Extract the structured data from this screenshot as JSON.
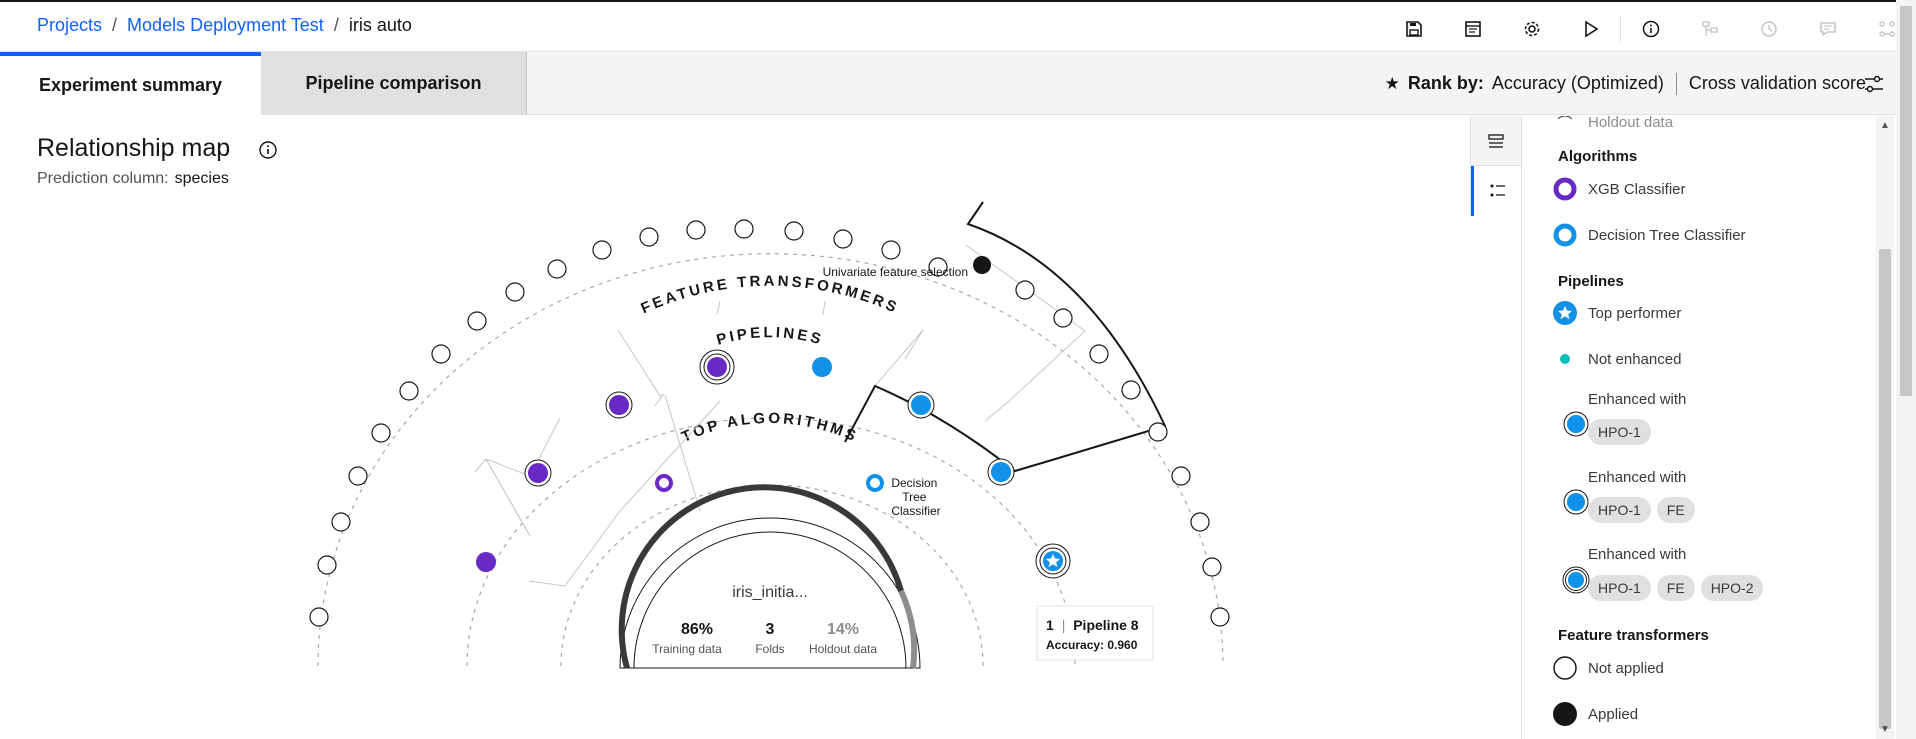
{
  "breadcrumb": {
    "projects": "Projects",
    "project": "Models Deployment Test",
    "current": "iris auto",
    "sep": "/"
  },
  "toolbar": {
    "icons": [
      "save-icon",
      "notebook-icon",
      "settings-icon",
      "run-icon",
      "info-icon",
      "pipeline-icon",
      "history-icon",
      "comment-icon",
      "compare-icon"
    ]
  },
  "tabs": {
    "summary": "Experiment summary",
    "comparison": "Pipeline comparison"
  },
  "rank_by": {
    "label": "Rank by:",
    "metric": "Accuracy (Optimized)",
    "score": "Cross validation score"
  },
  "map": {
    "title": "Relationship map",
    "prediction_label": "Prediction column:",
    "prediction_value": "species",
    "ring_feature_transformers": "FEATURE TRANSFORMERS",
    "ring_pipelines": "PIPELINES",
    "ring_top_algorithms": "TOP ALGORITHMS",
    "feature_label": "Univariate feature selection",
    "algorithm_label_1": "Decision",
    "algorithm_label_2": "Tree",
    "algorithm_label_3": "Classifier",
    "center_name": "iris_initia...",
    "stat_training_value": "86%",
    "stat_training_label": "Training data",
    "stat_folds_value": "3",
    "stat_folds_label": "Folds",
    "stat_holdout_value": "14%",
    "stat_holdout_label": "Holdout data",
    "tooltip_rank": "1",
    "tooltip_sep": "|",
    "tooltip_name": "Pipeline 8",
    "tooltip_metric": "Accuracy: 0.960"
  },
  "legend": {
    "partial_top": "Holdout data",
    "algorithms_heading": "Algorithms",
    "algo_xgb": "XGB Classifier",
    "algo_dt": "Decision Tree Classifier",
    "pipelines_heading": "Pipelines",
    "top_performer": "Top performer",
    "not_enhanced": "Not enhanced",
    "enhanced_1": "Enhanced with",
    "enhanced_2": "Enhanced with",
    "enhanced_3": "Enhanced with",
    "tag_hpo1": "HPO-1",
    "tag_fe": "FE",
    "tag_hpo2": "HPO-2",
    "feature_heading": "Feature transformers",
    "not_applied": "Not applied",
    "applied": "Applied"
  },
  "colors": {
    "xgb": "#6929c4",
    "dt": "#1192e8",
    "accent": "#0f62fe"
  }
}
